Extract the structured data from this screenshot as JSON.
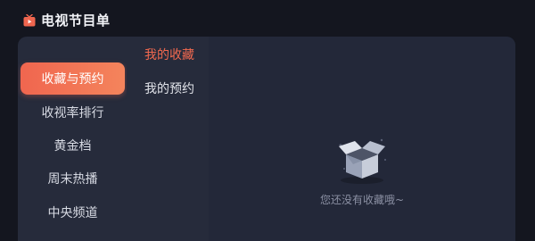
{
  "window": {
    "title": "电视节目单"
  },
  "sidebar": {
    "items": [
      {
        "label": "收藏与预约",
        "active": true
      },
      {
        "label": "收视率排行",
        "active": false
      },
      {
        "label": "黄金档",
        "active": false
      },
      {
        "label": "周末热播",
        "active": false
      },
      {
        "label": "中央频道",
        "active": false
      }
    ]
  },
  "subnav": {
    "items": [
      {
        "label": "我的收藏",
        "active": true
      },
      {
        "label": "我的预约",
        "active": false
      }
    ]
  },
  "content": {
    "empty_message": "您还没有收藏哦~"
  },
  "colors": {
    "accent": "#f0664f",
    "background": "#14161f",
    "panel": "#262b3b"
  },
  "icons": {
    "title": "tv-icon",
    "empty": "empty-box-icon"
  }
}
